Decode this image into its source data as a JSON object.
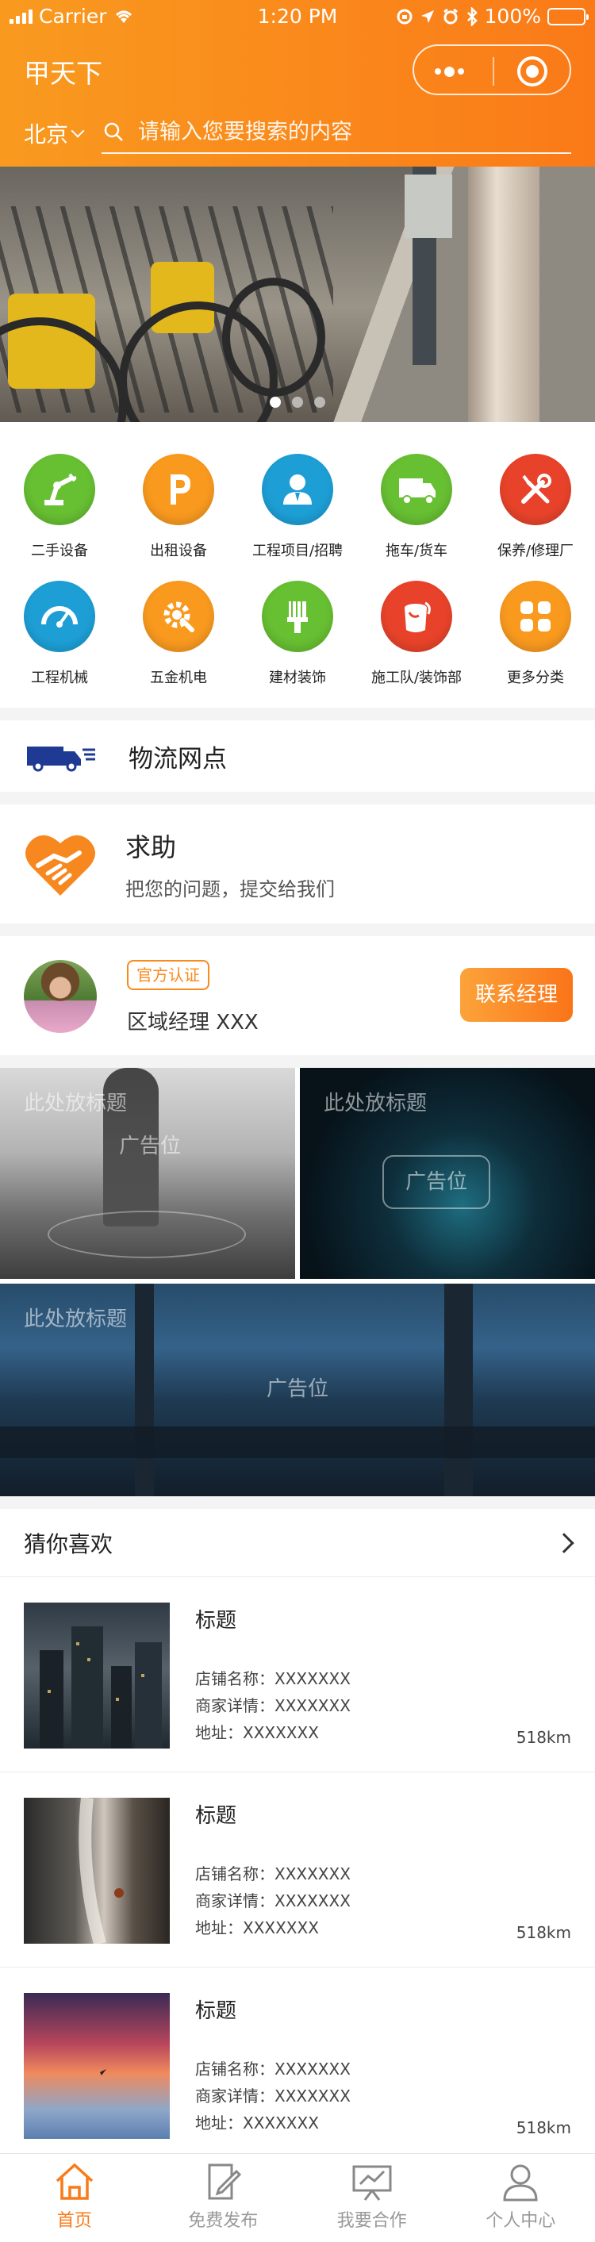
{
  "status_bar": {
    "carrier": "Carrier",
    "time": "1:20 PM",
    "battery": "100%"
  },
  "header": {
    "title": "甲天下",
    "city": "北京",
    "search_placeholder": "请输入您要搜索的内容"
  },
  "banner": {
    "page_count": 3,
    "active_index": 0
  },
  "categories": [
    {
      "label": "二手设备",
      "icon": "robot-arm-icon",
      "color": "#67bf32"
    },
    {
      "label": "出租设备",
      "icon": "parking-p-icon",
      "color": "#f99a1f"
    },
    {
      "label": "工程项目/招聘",
      "icon": "person-icon",
      "color": "#1d9fd6"
    },
    {
      "label": "拖车/货车",
      "icon": "truck-icon",
      "color": "#67bf32"
    },
    {
      "label": "保养/修理厂",
      "icon": "wrench-screwdriver-icon",
      "color": "#e8432a"
    },
    {
      "label": "工程机械",
      "icon": "gauge-icon",
      "color": "#1d9fd6"
    },
    {
      "label": "五金机电",
      "icon": "gear-wrench-icon",
      "color": "#f99a1f"
    },
    {
      "label": "建材装饰",
      "icon": "brush-icon",
      "color": "#67bf32"
    },
    {
      "label": "施工队/装饰部",
      "icon": "paint-bucket-icon",
      "color": "#e8432a"
    },
    {
      "label": "更多分类",
      "icon": "grid-icon",
      "color": "#f99a1f"
    }
  ],
  "logistics": {
    "label": "物流网点",
    "icon": "delivery-truck-icon"
  },
  "help": {
    "title": "求助",
    "subtitle": "把您的问题，提交给我们"
  },
  "manager": {
    "badge": "官方认证",
    "name": "区域经理 XXX",
    "button": "联系经理"
  },
  "ads": [
    {
      "title": "此处放标题",
      "slot": "广告位"
    },
    {
      "title": "此处放标题",
      "slot": "广告位"
    },
    {
      "title": "此处放标题",
      "slot": "广告位"
    }
  ],
  "guess": {
    "heading": "猜你喜欢",
    "items": [
      {
        "title": "标题",
        "shop": "店铺名称：XXXXXXX",
        "detail": "商家详情：XXXXXXX",
        "address": "地址：XXXXXXX",
        "distance": "518km"
      },
      {
        "title": "标题",
        "shop": "店铺名称：XXXXXXX",
        "detail": "商家详情：XXXXXXX",
        "address": "地址：XXXXXXX",
        "distance": "518km"
      },
      {
        "title": "标题",
        "shop": "店铺名称：XXXXXXX",
        "detail": "商家详情：XXXXXXX",
        "address": "地址：XXXXXXX",
        "distance": "518km"
      }
    ]
  },
  "tabbar": [
    {
      "label": "首页",
      "icon": "home-icon",
      "active": true
    },
    {
      "label": "免费发布",
      "icon": "edit-document-icon",
      "active": false
    },
    {
      "label": "我要合作",
      "icon": "presentation-board-icon",
      "active": false
    },
    {
      "label": "个人中心",
      "icon": "user-icon",
      "active": false
    }
  ],
  "colors": {
    "brand": "#fa7a18",
    "brand_light": "#f99a1f"
  }
}
